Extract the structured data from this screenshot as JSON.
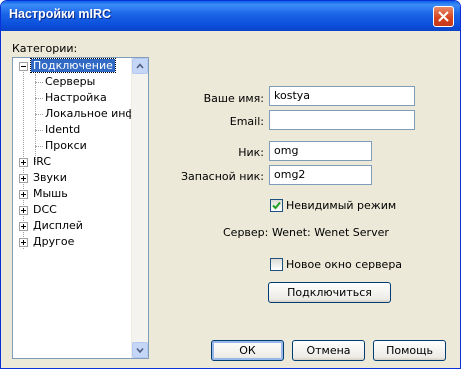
{
  "window": {
    "title": "Настройки mIRC"
  },
  "categories_label": "Категории:",
  "tree": {
    "connection": "Подключение",
    "children": [
      "Серверы",
      "Настройка",
      "Локальное инфо",
      "Identd",
      "Прокси"
    ],
    "others": [
      "IRC",
      "Звуки",
      "Мышь",
      "DCC",
      "Дисплей",
      "Другое"
    ]
  },
  "form": {
    "name_label": "Ваше имя:",
    "name_value": "kostya",
    "email_label": "Email:",
    "email_value": "",
    "nick_label": "Ник:",
    "nick_value": "omg",
    "altnick_label": "Запасной ник:",
    "altnick_value": "omg2",
    "invisible_label": "Невидимый режим",
    "invisible_checked": true,
    "server_label": "Сервер:",
    "server_value": "Wenet: Wenet Server",
    "newwindow_label": "Новое окно сервера",
    "newwindow_checked": false,
    "connect_button": "Подключиться"
  },
  "buttons": {
    "ok": "ОК",
    "cancel": "Отмена",
    "help": "Помощь"
  }
}
